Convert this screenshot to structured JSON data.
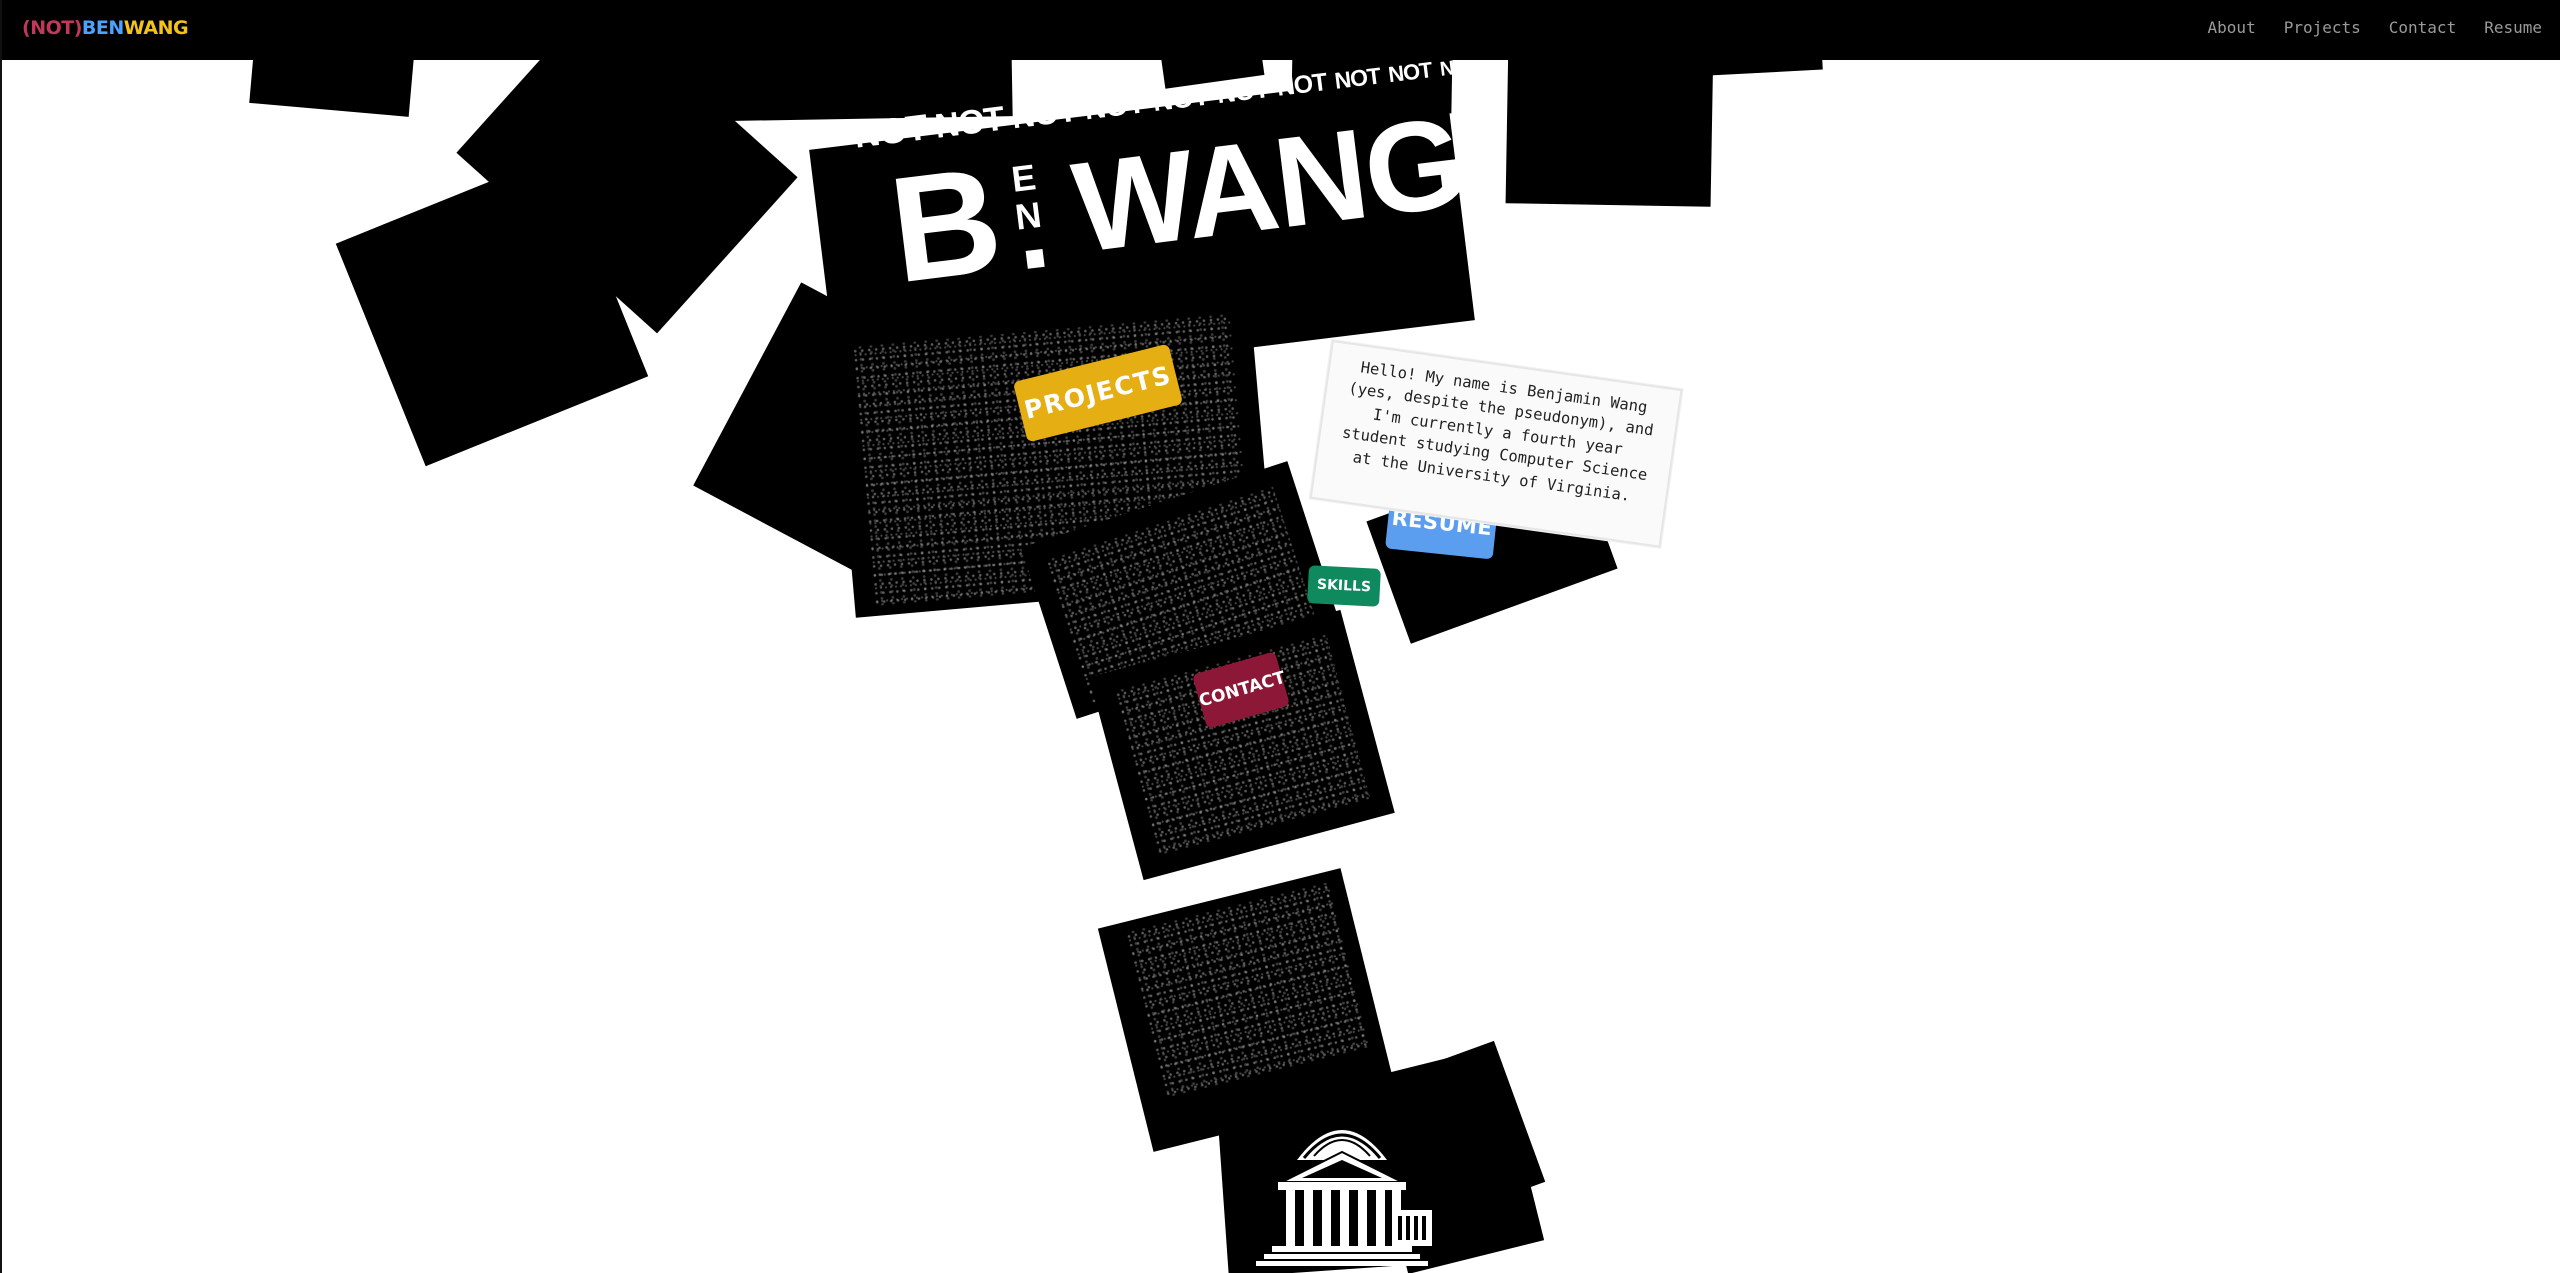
{
  "brand": {
    "paren_open": "(",
    "not": "NOT",
    "paren_close": ")",
    "ben": "BEN",
    "wang": "WANG",
    "colors": {
      "paren_open": "#c0395a",
      "not": "#c0395a",
      "paren_close": "#c0395a",
      "ben": "#4aa3ff",
      "wang": "#f2c318"
    }
  },
  "nav": {
    "items": [
      {
        "label": "About"
      },
      {
        "label": "Projects"
      },
      {
        "label": "Contact"
      },
      {
        "label": "Resume"
      }
    ]
  },
  "hero": {
    "nots": [
      "NOT",
      "NOT",
      "NOT",
      "NOT",
      "NOT",
      "NOT",
      "NOT",
      "NOT",
      "NOT",
      "NOT"
    ],
    "name_b": "B",
    "name_e": "E",
    "name_n": "N",
    "name_dot": ".",
    "name_wang": "WANG"
  },
  "buttons": {
    "projects": {
      "label": "PROJECTS",
      "color": "#e5ae12"
    },
    "resume": {
      "label": "RESUME",
      "color": "#5b9ef0"
    },
    "skills": {
      "label": "SKILLS",
      "color": "#0f8a5f"
    },
    "contact": {
      "label": "CONTACT",
      "color": "#8c1736"
    }
  },
  "bio": {
    "lines": [
      "Hello! My name is Benjamin Wang",
      "(yes, despite the pseudonym), and",
      "I'm currently a fourth year",
      "student studying Computer Science",
      "at the University of Virginia."
    ]
  },
  "illustration": {
    "icon": "rotunda-building-icon"
  }
}
